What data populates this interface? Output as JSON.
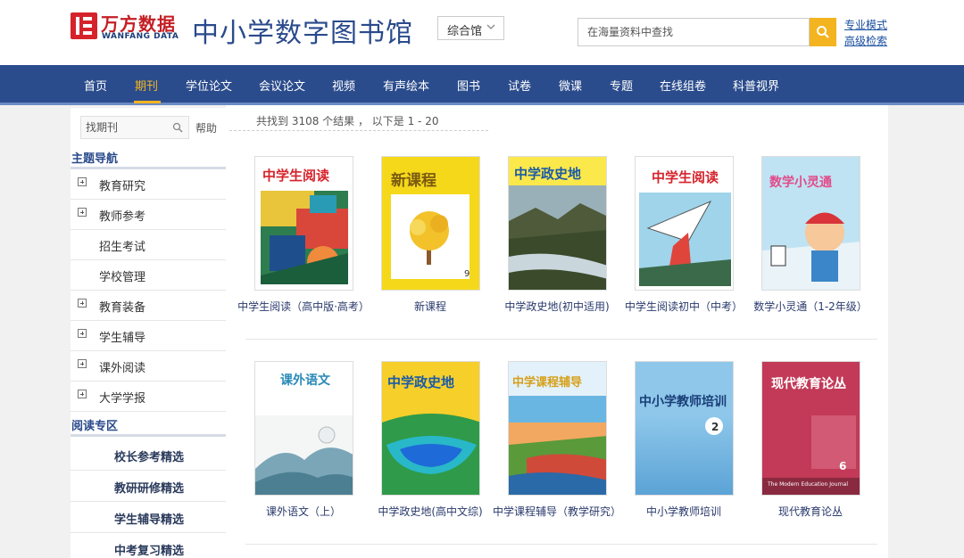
{
  "header": {
    "logo_cn": "万方数据",
    "logo_en": "WANFANG DATA",
    "site_title": "中小学数字图书馆",
    "library_select": "综合馆",
    "search_placeholder": "在海量资料中查找",
    "links": [
      "专业模式",
      "高级检索"
    ]
  },
  "nav": {
    "items": [
      "首页",
      "期刊",
      "学位论文",
      "会议论文",
      "视频",
      "有声绘本",
      "图书",
      "试卷",
      "微课",
      "专题",
      "在线组卷",
      "科普视界"
    ],
    "active_index": 1
  },
  "sidebar": {
    "search_placeholder": "找期刊",
    "help": "帮助",
    "topic_heading": "主题导航",
    "categories": [
      {
        "label": "教育研究",
        "expandable": true
      },
      {
        "label": "教师参考",
        "expandable": true
      },
      {
        "label": "招生考试",
        "expandable": false
      },
      {
        "label": "学校管理",
        "expandable": false
      },
      {
        "label": "教育装备",
        "expandable": true
      },
      {
        "label": "学生辅导",
        "expandable": true
      },
      {
        "label": "课外阅读",
        "expandable": true
      },
      {
        "label": "大学学报",
        "expandable": true
      }
    ],
    "reading_heading": "阅读专区",
    "reading_items": [
      "校长参考精选",
      "教研研修精选",
      "学生辅导精选",
      "中考复习精选"
    ]
  },
  "results": {
    "summary": "共找到 3108 个结果 ， 以下是 1 - 20"
  },
  "journals": [
    {
      "title": "中学生阅读（高中版·高考）",
      "cover_text": "中学生阅读",
      "cover_sub": "",
      "cover_num": ""
    },
    {
      "title": "新课程",
      "cover_text": "新课程",
      "cover_sub": "",
      "cover_num": "9"
    },
    {
      "title": "中学政史地(初中适用)",
      "cover_text": "中学政史地",
      "cover_sub": "",
      "cover_num": ""
    },
    {
      "title": "中学生阅读初中（中考）",
      "cover_text": "中学生阅读",
      "cover_sub": "",
      "cover_num": ""
    },
    {
      "title": "数学小灵通（1-2年级）",
      "cover_text": "数学小灵通",
      "cover_sub": "",
      "cover_num": ""
    },
    {
      "title": "课外语文（上）",
      "cover_text": "课外语文",
      "cover_sub": "",
      "cover_num": ""
    },
    {
      "title": "中学政史地(高中文综)",
      "cover_text": "中学政史地",
      "cover_sub": "",
      "cover_num": ""
    },
    {
      "title": "中学课程辅导（教学研究）",
      "cover_text": "中学课程辅导",
      "cover_sub": "",
      "cover_num": ""
    },
    {
      "title": "中小学教师培训",
      "cover_text": "中小学教师培训",
      "cover_sub": "",
      "cover_num": "2"
    },
    {
      "title": "现代教育论丛",
      "cover_text": "现代教育论丛",
      "cover_sub": "The Modern Education Journal",
      "cover_num": "6"
    }
  ],
  "colors": {
    "nav_bg": "#2b4c8c",
    "accent": "#f3b420",
    "brand_red": "#d6232b",
    "title_blue": "#2a4a8c"
  }
}
